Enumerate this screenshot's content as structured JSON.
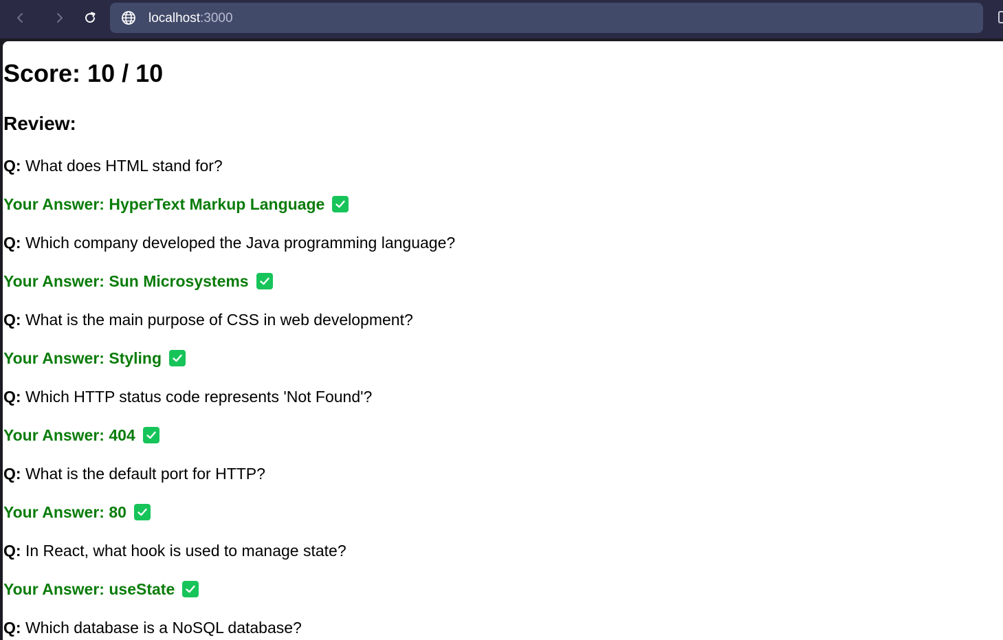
{
  "browser": {
    "url_host": "localhost",
    "url_port": ":3000"
  },
  "result": {
    "score": "Score: 10 / 10",
    "review_heading": "Review:",
    "question_prefix": "Q:",
    "answer_prefix": "Your Answer:"
  },
  "review_items": [
    {
      "question": "What does HTML stand for?",
      "answer": "HyperText Markup Language",
      "icon": "checkmark-icon"
    },
    {
      "question": "Which company developed the Java programming language?",
      "answer": "Sun Microsystems",
      "icon": "checkmark-icon"
    },
    {
      "question": "What is the main purpose of CSS in web development?",
      "answer": "Styling",
      "icon": "checkmark-icon"
    },
    {
      "question": "Which HTTP status code represents 'Not Found'?",
      "answer": "404",
      "icon": "checkmark-icon"
    },
    {
      "question": "What is the default port for HTTP?",
      "answer": "80",
      "icon": "checkmark-icon"
    },
    {
      "question": "In React, what hook is used to manage state?",
      "answer": "useState",
      "icon": "checkmark-icon"
    },
    {
      "question": "Which database is a NoSQL database?"
    }
  ],
  "colors": {
    "answer_green": "#0a7c0a",
    "check_green": "#17c45a",
    "toolbar": "#2b2a45",
    "address_bar": "#424a6a"
  }
}
